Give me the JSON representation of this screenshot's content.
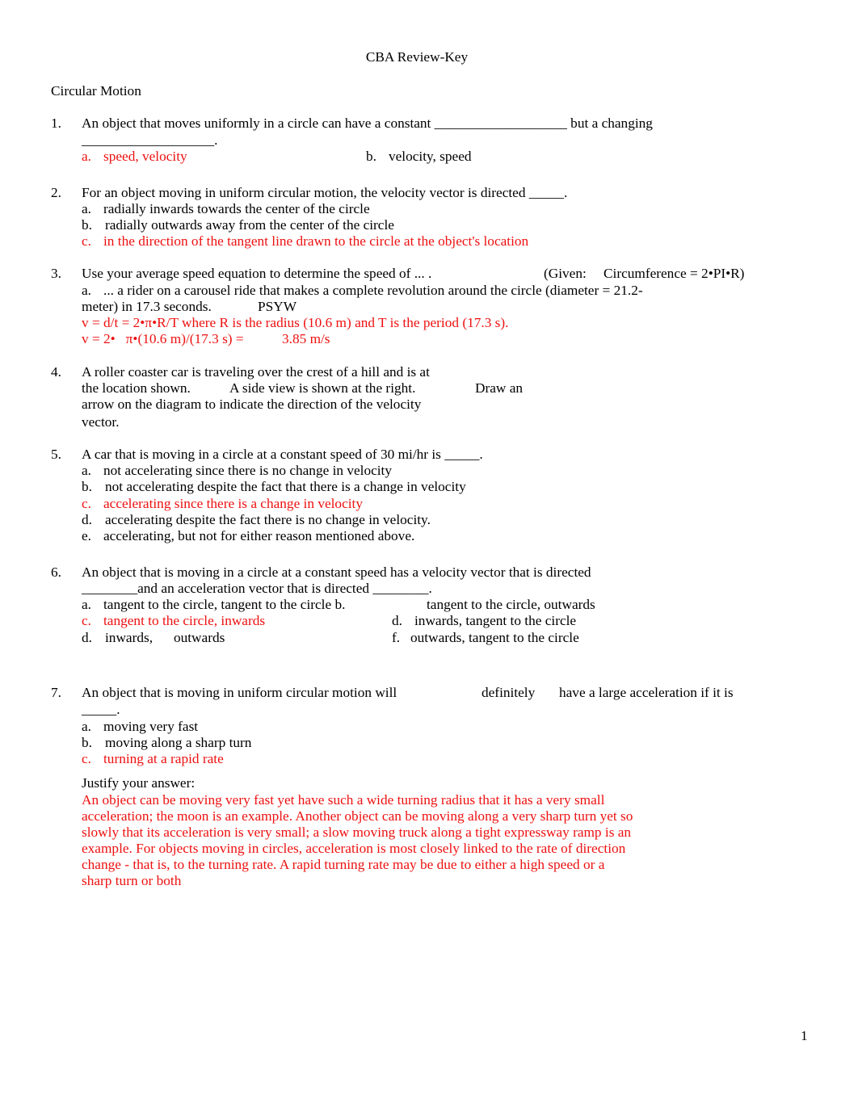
{
  "document": {
    "title": "CBA Review-Key",
    "section": "Circular Motion",
    "page_number": "1",
    "answer_color": "#ee1111"
  },
  "questions": [
    {
      "number": "1.",
      "stem_lines": [
        "An object that moves uniformly in a circle can have a constant ___________________ but a changing",
        "___________________."
      ],
      "options": [
        {
          "letter": "a.",
          "text": "speed, velocity",
          "correct": true
        },
        {
          "letter": "b.",
          "text": "velocity, speed",
          "correct": false
        }
      ]
    },
    {
      "number": "2.",
      "stem_lines": [
        "For an object moving in uniform circular motion, the velocity vector is directed _____."
      ],
      "options": [
        {
          "letter": "a.",
          "text": "radially inwards towards the center of the circle",
          "correct": false
        },
        {
          "letter": "b.",
          "text": "radially outwards away from the center of the circle",
          "correct": false
        },
        {
          "letter": "c.",
          "text": "in the direction of the tangent line drawn to the circle at the object's location",
          "correct": true
        }
      ]
    },
    {
      "number": "3.",
      "stem_lines": [
        "Use your average speed equation to determine the speed of ... ."
      ],
      "given": "(Given:",
      "given_formula": "Circumference = 2•PI•R)",
      "sub_letter": "a.",
      "sub_lines": [
        "... a rider on a carousel ride that makes a complete revolution around the circle (diameter = 21.2-",
        "meter) in 17.3 seconds."
      ],
      "psyw": "PSYW",
      "answer_lines": [
        "v = d/t = 2•π•R/T where R is the radius (10.6 m) and T is the period (17.3 s).",
        "v = 2•   π•(10.6 m)/(17.3 s) ="
      ],
      "answer_value": "3.85 m/s"
    },
    {
      "number": "4.",
      "stem_lines": [
        "A roller coaster car is traveling over the crest of a hill and is at",
        "the location shown.",
        "A side view is shown at the right.",
        "Draw an",
        "arrow on the diagram to indicate the direction of the velocity",
        "vector."
      ]
    },
    {
      "number": "5.",
      "stem_lines": [
        "A car that is moving in a circle at a constant speed of 30 mi/hr is _____."
      ],
      "options": [
        {
          "letter": "a.",
          "text": "not accelerating since there is no change in velocity",
          "correct": false
        },
        {
          "letter": "b.",
          "text": "not accelerating despite the fact that there is a change in velocity",
          "correct": false
        },
        {
          "letter": "c.",
          "text": "accelerating since there is a change in velocity",
          "correct": true
        },
        {
          "letter": "d.",
          "text": "accelerating despite the fact there is no change in velocity.",
          "correct": false
        },
        {
          "letter": "e.",
          "text": "accelerating, but not for either reason mentioned above.",
          "correct": false
        }
      ]
    },
    {
      "number": "6.",
      "stem_lines": [
        "An object that is moving in a circle at a constant speed has a velocity vector that is directed",
        "________and an acceleration vector that is directed ________."
      ],
      "options": [
        {
          "letter": "a.",
          "text": "tangent to the circle, tangent to the circle b.",
          "correct": false
        },
        {
          "letter": "",
          "text": "tangent to the circle, outwards",
          "correct": false
        },
        {
          "letter": "c.",
          "text": "tangent to the circle, inwards",
          "correct": true
        },
        {
          "letter": "d.",
          "text": "inwards, tangent to the circle",
          "correct": false
        },
        {
          "letter": "d.",
          "text": "inwards,      outwards",
          "correct": false
        },
        {
          "letter": "f.",
          "text": "outwards, tangent to the circle",
          "correct": false
        }
      ]
    },
    {
      "number": "7.",
      "stem_lines": [
        "An object that is moving in uniform circular motion will",
        "definitely",
        "have a large acceleration if it is",
        "_____."
      ],
      "options": [
        {
          "letter": "a.",
          "text": "moving very fast",
          "correct": false
        },
        {
          "letter": "b.",
          "text": "moving along a sharp turn",
          "correct": false
        },
        {
          "letter": "c.",
          "text": "turning at a rapid rate",
          "correct": true
        }
      ],
      "justify_label": "Justify your answer:",
      "justify_lines": [
        "An object can be moving very fast yet have such a wide turning radius that it has a very small",
        "acceleration; the moon is an example. Another object can be moving along a very sharp turn yet so",
        "slowly that its acceleration is very small; a slow moving truck along a tight expressway ramp is an",
        "example. For objects moving in circles, acceleration is most closely linked to the rate of direction",
        "change - that is, to the turning rate. A rapid turning rate may be due to either a high speed or a",
        "sharp turn or both"
      ]
    }
  ]
}
